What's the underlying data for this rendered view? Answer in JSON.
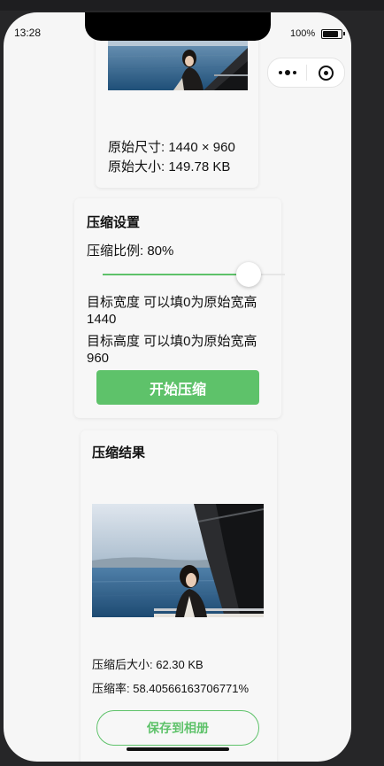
{
  "status_bar": {
    "time": "13:28",
    "battery_percent": "100%"
  },
  "capsule": {
    "more_icon": "more-dots-icon",
    "close_icon": "target-circle-icon"
  },
  "original": {
    "size_label": "原始尺寸: 1440 × 960",
    "file_size_label": "原始大小: 149.78 KB"
  },
  "settings": {
    "title": "压缩设置",
    "ratio_label": "压缩比例: 80%",
    "ratio_value": 0.8,
    "width_label": "目标宽度 可以填0为原始宽高",
    "width_value": "1440",
    "height_label": "目标高度 可以填0为原始宽高",
    "height_value": "960",
    "start_button": "开始压缩"
  },
  "result": {
    "title": "压缩结果",
    "size_label": "压缩后大小: 62.30 KB",
    "rate_label": "压缩率: 58.40566163706771%",
    "save_button": "保存到相册"
  },
  "colors": {
    "accent": "#5ec26a",
    "background": "#f6f6f6"
  }
}
